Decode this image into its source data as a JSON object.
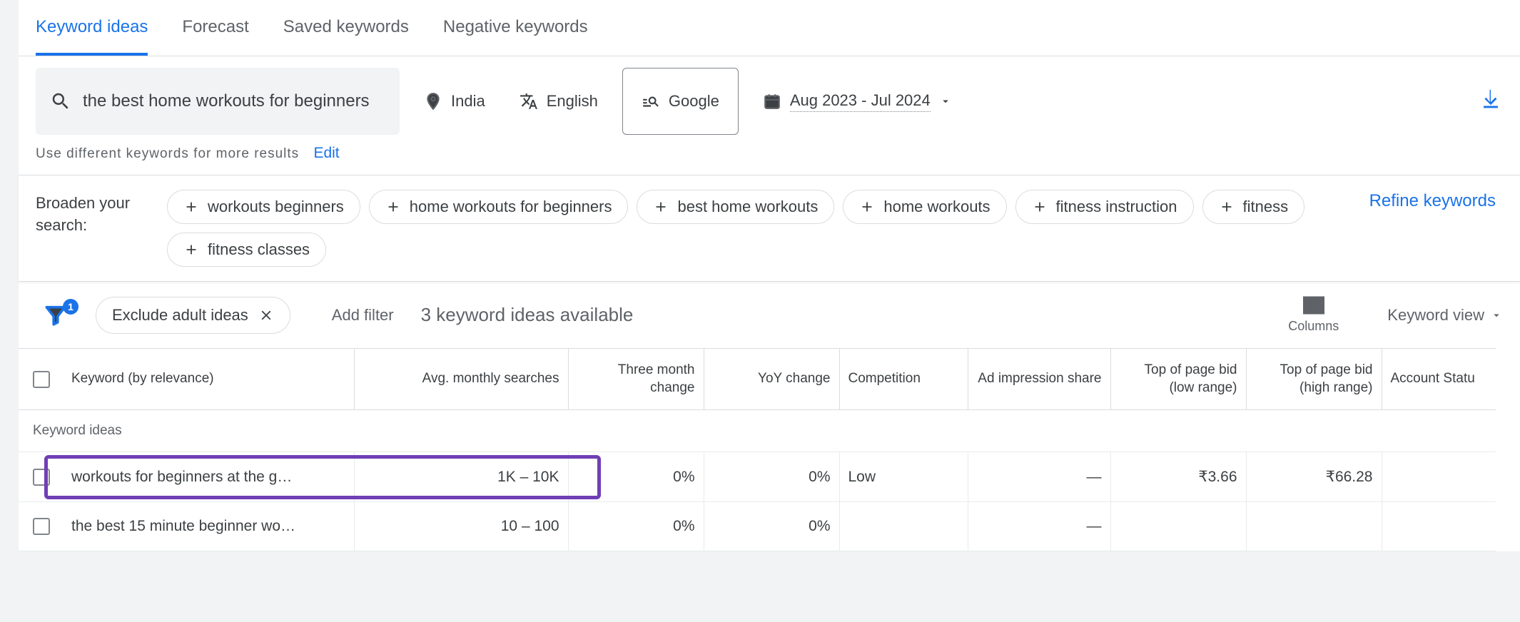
{
  "tabs": {
    "keyword_ideas": "Keyword ideas",
    "forecast": "Forecast",
    "saved_keywords": "Saved keywords",
    "negative_keywords": "Negative keywords"
  },
  "search": {
    "query": "the best home workouts for beginners",
    "location": "India",
    "language": "English",
    "network": "Google",
    "date_range": "Aug 2023 - Jul 2024"
  },
  "hint": {
    "text": "Use different keywords for more results",
    "edit": "Edit"
  },
  "broaden": {
    "label": "Broaden your search:",
    "chips": [
      "workouts beginners",
      "home workouts for beginners",
      "best home workouts",
      "home workouts",
      "fitness instruction",
      "fitness",
      "fitness classes"
    ],
    "refine": "Refine keywords"
  },
  "toolbar": {
    "funnel_badge": "1",
    "exclude": "Exclude adult ideas",
    "add_filter": "Add filter",
    "available": "3 keyword ideas available",
    "columns": "Columns",
    "view": "Keyword view"
  },
  "table": {
    "headers": {
      "keyword": "Keyword (by relevance)",
      "avg": "Avg. monthly searches",
      "three_month": "Three month change",
      "yoy": "YoY change",
      "competition": "Competition",
      "ad_share": "Ad impression share",
      "bid_low": "Top of page bid (low range)",
      "bid_high": "Top of page bid (high range)",
      "status": "Account Statu"
    },
    "section_label": "Keyword ideas",
    "rows": [
      {
        "keyword": "workouts for beginners at the g…",
        "avg": "1K – 10K",
        "three_month": "0%",
        "yoy": "0%",
        "competition": "Low",
        "ad_share": "—",
        "bid_low": "₹3.66",
        "bid_high": "₹66.28",
        "status": ""
      },
      {
        "keyword": "the best 15 minute beginner wo…",
        "avg": "10 – 100",
        "three_month": "0%",
        "yoy": "0%",
        "competition": "",
        "ad_share": "—",
        "bid_low": "",
        "bid_high": "",
        "status": ""
      }
    ]
  }
}
